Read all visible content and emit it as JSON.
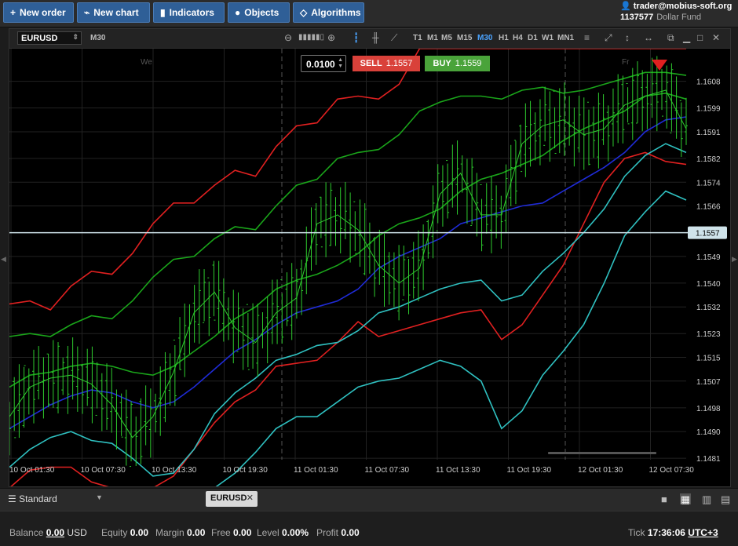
{
  "toolbar": {
    "new_order": "New order",
    "new_chart": "New chart",
    "indicators": "Indicators",
    "objects": "Objects",
    "algorithms": "Algorithms"
  },
  "account": {
    "user": "trader@mobius-soft.org",
    "id": "1137577",
    "fund": "Dollar Fund"
  },
  "chart_header": {
    "symbol": "EURUSD",
    "timeframe": "M30",
    "timeframes": [
      "T1",
      "M1",
      "M5",
      "M15",
      "M30",
      "H1",
      "H4",
      "D1",
      "W1",
      "MN1"
    ],
    "active_timeframe": "M30"
  },
  "order": {
    "quantity": "0.0100",
    "sell_label": "SELL",
    "sell_price": "1.1557",
    "buy_label": "BUY",
    "buy_price": "1.1559"
  },
  "chart_data": {
    "type": "line",
    "symbol": "EURUSD",
    "timeframe": "M30",
    "day_labels": [
      "We",
      "Fr"
    ],
    "x_tick_labels": [
      "10 Oct 01:30",
      "10 Oct 07:30",
      "10 Oct 13:30",
      "10 Oct 19:30",
      "11 Oct 01:30",
      "11 Oct 07:30",
      "11 Oct 13:30",
      "11 Oct 19:30",
      "12 Oct 01:30",
      "12 Oct 07:30"
    ],
    "y_tick_labels": [
      "1.1608",
      "1.1599",
      "1.1591",
      "1.1582",
      "1.1574",
      "1.1566",
      "1.1557",
      "1.1549",
      "1.1540",
      "1.1532",
      "1.1523",
      "1.1515",
      "1.1507",
      "1.1498",
      "1.1490",
      "1.1481"
    ],
    "ylim": [
      1.1471,
      1.1619
    ],
    "current_price": "1.1557",
    "series": [
      {
        "role": "middle",
        "color": "#1f2bd6",
        "values": [
          1.1491,
          1.1495,
          1.1499,
          1.1502,
          1.1504,
          1.1503,
          1.15,
          1.1498,
          1.15,
          1.1505,
          1.1511,
          1.1517,
          1.1521,
          1.1526,
          1.153,
          1.1532,
          1.1534,
          1.1538,
          1.1545,
          1.1549,
          1.1552,
          1.1555,
          1.156,
          1.1562,
          1.1564,
          1.1566,
          1.1567,
          1.1571,
          1.1575,
          1.1579,
          1.1584,
          1.1591,
          1.1595,
          1.1596
        ]
      },
      {
        "role": "outer-band",
        "color": "#e02020",
        "values": [
          1.1533,
          1.1534,
          1.1531,
          1.1539,
          1.1544,
          1.1543,
          1.155,
          1.156,
          1.1567,
          1.1567,
          1.1573,
          1.1578,
          1.1576,
          1.1586,
          1.1593,
          1.1594,
          1.1602,
          1.1603,
          1.1602,
          1.1607,
          1.1619,
          1.1619,
          1.1619,
          1.1619,
          1.1619,
          1.1619,
          1.1619,
          1.1619,
          1.1619,
          1.1619,
          1.1619,
          1.1619,
          1.1619,
          1.1619
        ]
      },
      {
        "role": "outer-band",
        "color": "#e02020",
        "values": [
          1.1471,
          1.1477,
          1.1478,
          1.1478,
          1.1473,
          1.1471,
          1.1471,
          1.1471,
          1.1475,
          1.1484,
          1.1493,
          1.15,
          1.1504,
          1.1512,
          1.1513,
          1.1514,
          1.152,
          1.1527,
          1.1522,
          1.1524,
          1.1526,
          1.1528,
          1.153,
          1.1531,
          1.1521,
          1.1526,
          1.1536,
          1.1546,
          1.156,
          1.1574,
          1.1582,
          1.1584,
          1.1581,
          1.158
        ]
      },
      {
        "role": "inner-band",
        "color": "#1aa51a",
        "values": [
          1.1522,
          1.1523,
          1.1522,
          1.1526,
          1.1529,
          1.1528,
          1.1534,
          1.1542,
          1.1548,
          1.1549,
          1.1555,
          1.1559,
          1.1558,
          1.1566,
          1.1573,
          1.1575,
          1.1582,
          1.1584,
          1.1585,
          1.159,
          1.1598,
          1.1601,
          1.1603,
          1.1603,
          1.1602,
          1.1605,
          1.1606,
          1.1604,
          1.1605,
          1.1607,
          1.1609,
          1.1611,
          1.1611,
          1.161
        ]
      },
      {
        "role": "inner-band",
        "color": "#1aa51a",
        "values": [
          1.1505,
          1.1509,
          1.151,
          1.1512,
          1.1513,
          1.1512,
          1.151,
          1.1509,
          1.1512,
          1.1517,
          1.1522,
          1.1528,
          1.1532,
          1.1538,
          1.1541,
          1.1543,
          1.1546,
          1.155,
          1.1556,
          1.156,
          1.1562,
          1.1565,
          1.1571,
          1.1575,
          1.1577,
          1.158,
          1.1583,
          1.1588,
          1.1592,
          1.1595,
          1.1598,
          1.1603,
          1.1604,
          1.1602
        ]
      },
      {
        "role": "lower-band",
        "color": "#2fc0c0",
        "values": [
          1.1478,
          1.1484,
          1.1488,
          1.149,
          1.1487,
          1.1486,
          1.1481,
          1.1475,
          1.1476,
          1.1484,
          1.1496,
          1.1503,
          1.1508,
          1.1514,
          1.1516,
          1.1519,
          1.152,
          1.1524,
          1.153,
          1.1532,
          1.1535,
          1.1538,
          1.154,
          1.1541,
          1.1534,
          1.1536,
          1.1544,
          1.155,
          1.1557,
          1.1565,
          1.1576,
          1.1583,
          1.1587,
          1.1584
        ]
      },
      {
        "role": "lower-band",
        "color": "#2fc0c0",
        "values": [
          1.1471,
          1.1471,
          1.1471,
          1.1471,
          1.1471,
          1.1471,
          1.1471,
          1.1471,
          1.1471,
          1.1471,
          1.1471,
          1.1476,
          1.1483,
          1.1491,
          1.1495,
          1.1495,
          1.15,
          1.1505,
          1.1507,
          1.1508,
          1.1511,
          1.1514,
          1.1512,
          1.1507,
          1.1491,
          1.1497,
          1.1509,
          1.1517,
          1.1526,
          1.154,
          1.1556,
          1.1564,
          1.1571,
          1.1568
        ]
      },
      {
        "role": "price",
        "color": "#2ecc2e",
        "values": [
          1.1495,
          1.1505,
          1.1508,
          1.1509,
          1.1506,
          1.1499,
          1.1488,
          1.1495,
          1.151,
          1.153,
          1.1537,
          1.1525,
          1.152,
          1.153,
          1.1535,
          1.156,
          1.1563,
          1.1558,
          1.1546,
          1.154,
          1.1545,
          1.157,
          1.1577,
          1.1563,
          1.1563,
          1.1587,
          1.1593,
          1.1595,
          1.159,
          1.1592,
          1.16,
          1.1603,
          1.1605,
          1.1592
        ]
      }
    ]
  },
  "tabs": {
    "layout_name": "Standard",
    "chart_tab": "EURUSD"
  },
  "status": {
    "balance_label": "Balance",
    "balance": "0.00",
    "currency": "USD",
    "equity_label": "Equity",
    "equity": "0.00",
    "margin_label": "Margin",
    "margin": "0.00",
    "free_label": "Free",
    "free": "0.00",
    "level_label": "Level",
    "level": "0.00%",
    "profit_label": "Profit",
    "profit": "0.00",
    "tick_label": "Tick",
    "time": "17:36:06",
    "timezone": "UTC+3"
  },
  "colors": {
    "toolbar_button": "#2f5f97",
    "sell": "#d9413a",
    "buy": "#4aa33a",
    "active_timeframe": "#4aa3ff"
  }
}
